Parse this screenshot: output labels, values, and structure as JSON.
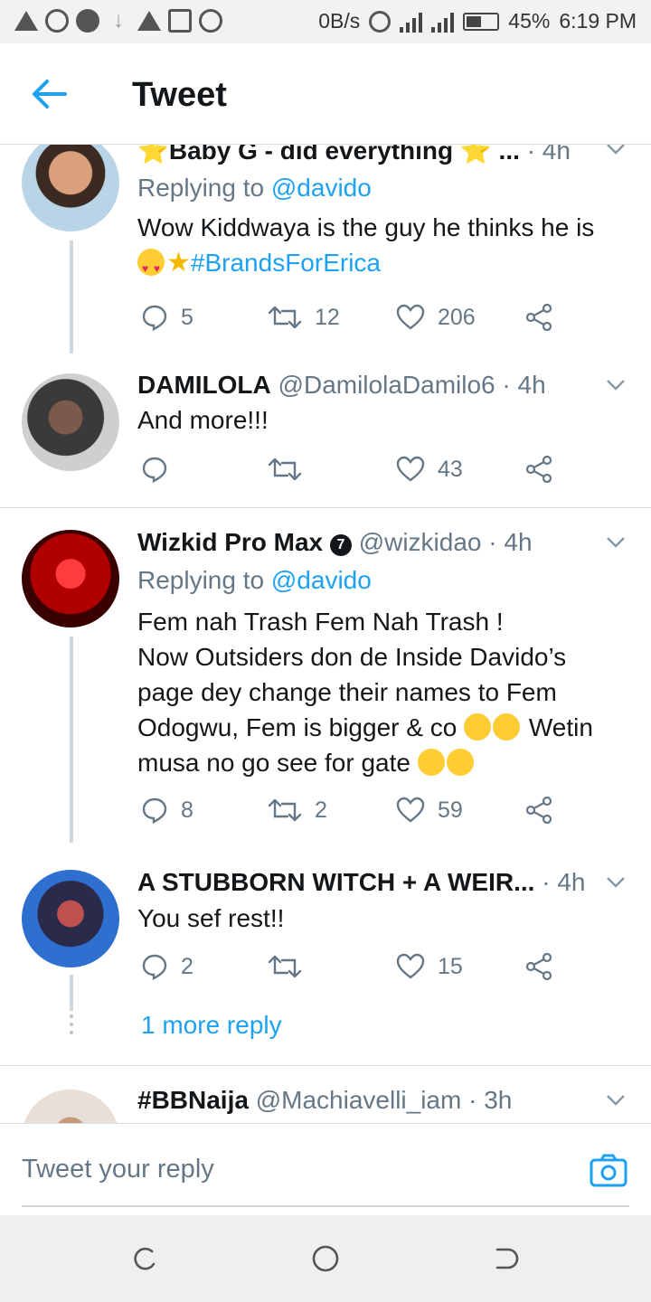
{
  "status_bar": {
    "speed": "0B/s",
    "battery": "45%",
    "time": "6:19 PM",
    "icons": [
      "warning-icon",
      "whatsapp-icon",
      "dot-icon",
      "download-icon",
      "alert-icon",
      "gallery-icon",
      "cloud-icon",
      "alarm-icon",
      "signal-icon",
      "battery-icon"
    ]
  },
  "app_bar": {
    "title": "Tweet"
  },
  "tweets": [
    {
      "name": "⭐Baby G - did everything ⭐ ...",
      "time": "· 4h",
      "replying_label": "Replying to ",
      "replying_to": "@davido",
      "text": "Wow Kiddwaya is the guy he thinks he is",
      "hashtag": "#BrandsForErica",
      "replies": "5",
      "retweets": "12",
      "likes": "206"
    },
    {
      "name": "DAMILOLA",
      "handle": "@DamilolaDamilo6",
      "time": "· 4h",
      "text": "And more!!!",
      "replies": "",
      "retweets": "",
      "likes": "43"
    },
    {
      "name": "Wizkid Pro Max",
      "badge": "7",
      "handle": "@wizkidao",
      "time": "· 4h",
      "replying_label": "Replying to ",
      "replying_to": "@davido",
      "text_lines": [
        "Fem nah Trash Fem Nah Trash !",
        "Now Outsiders don de Inside Davido’s",
        "page dey change their names to Fem",
        "Odogwu, Fem is bigger & co",
        "Wetin",
        "musa no go see for gate"
      ],
      "replies": "8",
      "retweets": "2",
      "likes": "59"
    },
    {
      "name": "A STUBBORN WITCH + A WEIR...",
      "time": "· 4h",
      "text": "You sef rest!!",
      "replies": "2",
      "retweets": "",
      "likes": "15"
    },
    {
      "name": "#BBNaija",
      "handle": "@Machiavelli_iam",
      "time": "· 3h"
    }
  ],
  "more_reply": "1 more reply",
  "reply_bar": {
    "placeholder": "Tweet your reply"
  },
  "colors": {
    "accent": "#1da1f2",
    "text": "#14171a",
    "muted": "#657786",
    "divider": "#d8dde2"
  }
}
